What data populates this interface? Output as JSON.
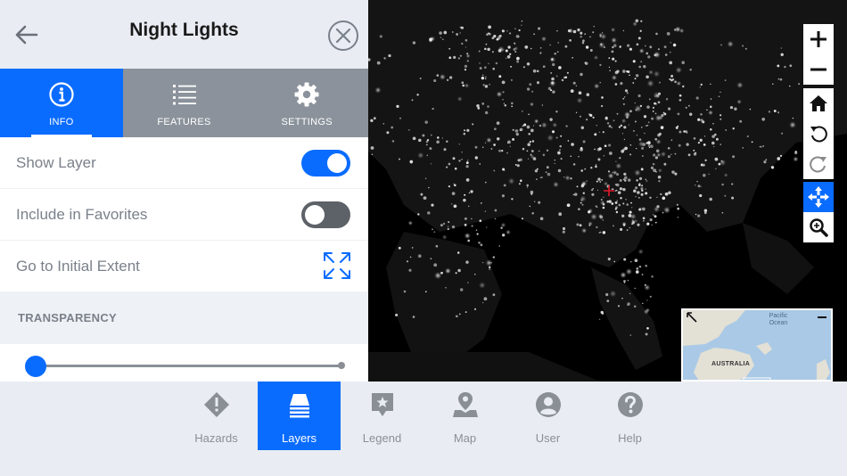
{
  "panel": {
    "title": "Night Lights",
    "tabs": [
      {
        "label": "INFO",
        "icon": "info-icon",
        "active": true
      },
      {
        "label": "FEATURES",
        "icon": "list-icon",
        "active": false
      },
      {
        "label": "SETTINGS",
        "icon": "gear-icon",
        "active": false
      }
    ],
    "rows": {
      "show_layer": {
        "label": "Show Layer",
        "toggle": "on"
      },
      "favorites": {
        "label": "Include in Favorites",
        "toggle": "off"
      },
      "initial_extent": {
        "label": "Go to Initial Extent",
        "icon": "expand-arrows-icon"
      }
    },
    "transparency": {
      "label": "TRANSPARENCY",
      "value": 0
    }
  },
  "map": {
    "controls": [
      "zoom-in-icon",
      "zoom-out-icon",
      "home-icon",
      "rotate-left-icon",
      "rotate-right-icon",
      "pan-icon",
      "zoom-box-icon"
    ],
    "active_control": "pan-icon",
    "overview": {
      "ocean_label_line1": "Pacific",
      "ocean_label_line2": "Ocean",
      "continent_label": "AUSTRALIA"
    }
  },
  "bottom_nav": {
    "items": [
      {
        "label": "Hazards",
        "icon": "hazard-icon"
      },
      {
        "label": "Layers",
        "icon": "layers-icon"
      },
      {
        "label": "Legend",
        "icon": "legend-icon"
      },
      {
        "label": "Map",
        "icon": "map-icon"
      },
      {
        "label": "User",
        "icon": "user-icon"
      },
      {
        "label": "Help",
        "icon": "help-icon"
      }
    ],
    "active": "Layers"
  },
  "colors": {
    "accent": "#0a6cff",
    "panel_bg": "#e9edf3",
    "tab_inactive": "#8b929b",
    "map_bg": "#000000"
  }
}
